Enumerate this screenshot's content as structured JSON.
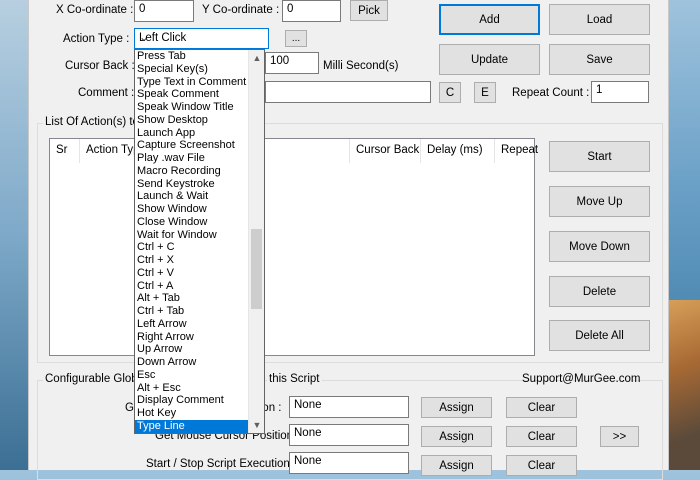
{
  "coords": {
    "x_label": "X Co-ordinate :",
    "x_value": "0",
    "y_label": "Y Co-ordinate :",
    "y_value": "0",
    "pick_label": "Pick"
  },
  "action_type": {
    "label": "Action Type :",
    "selected": "Left Click",
    "more_label": "..."
  },
  "cursor_back": {
    "label": "Cursor Back :",
    "delay_value": "100",
    "unit_label": "Milli Second(s)"
  },
  "comment": {
    "label": "Comment :",
    "c_label": "C",
    "e_label": "E",
    "repeat_label": "Repeat Count :",
    "repeat_value": "1"
  },
  "right_buttons": {
    "add": "Add",
    "load": "Load",
    "update": "Update",
    "save": "Save"
  },
  "list_group": {
    "label": "List Of Action(s) to",
    "columns": [
      "Sr",
      "Action Typ",
      "Cursor Back",
      "Delay (ms)",
      "Repeat"
    ]
  },
  "side_buttons": {
    "start": "Start",
    "move_up": "Move Up",
    "move_down": "Move Down",
    "delete": "Delete",
    "delete_all": "Delete All"
  },
  "global_group": {
    "label_left": "Configurable Globa",
    "label_right": "this Script",
    "support": "Support@MurGee.com",
    "rows": [
      {
        "label": "Ge",
        "label_tail": "ition :",
        "value": "None",
        "assign": "Assign",
        "clear": "Clear"
      },
      {
        "label": "Get Mouse Cursor Position :",
        "value": "None",
        "assign": "Assign",
        "clear": "Clear"
      },
      {
        "label": "Start / Stop Script Execution :",
        "value": "None",
        "assign": "Assign",
        "clear": "Clear"
      }
    ],
    "more_button": ">>"
  },
  "dropdown": {
    "items": [
      "Press Tab",
      "Special Key(s)",
      "Type Text in Comment",
      "Speak Comment",
      "Speak Window Title",
      "Show Desktop",
      "Launch App",
      "Capture Screenshot",
      "Play .wav File",
      "Macro Recording",
      "Send Keystroke",
      "Launch & Wait",
      "Show Window",
      "Close Window",
      "Wait for Window",
      "Ctrl + C",
      "Ctrl + X",
      "Ctrl + V",
      "Ctrl + A",
      "Alt + Tab",
      "Ctrl + Tab",
      "Left Arrow",
      "Right Arrow",
      "Up Arrow",
      "Down Arrow",
      "Esc",
      "Alt + Esc",
      "Display Comment",
      "Hot Key",
      "Type Line"
    ],
    "selected_index": 29,
    "scroll_fraction": 0.6
  },
  "icons": {
    "combo_arrow": "chevron-down-icon",
    "scroll_up": "scroll-up-arrow-icon",
    "scroll_down": "scroll-down-arrow-icon"
  }
}
